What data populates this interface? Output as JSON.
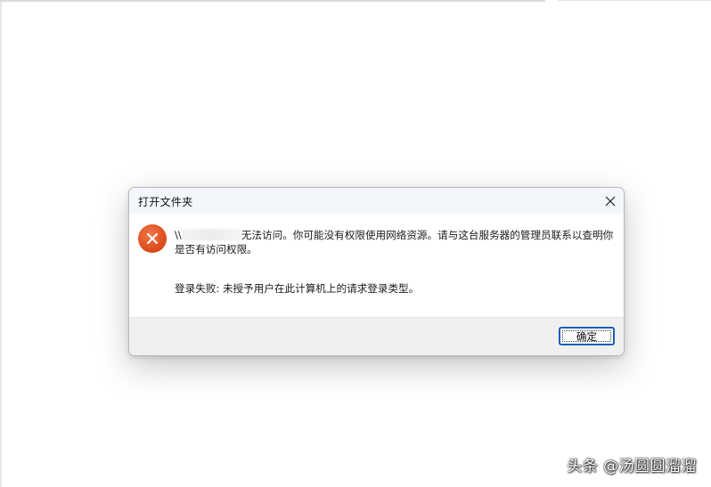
{
  "dialog": {
    "title": "打开文件夹",
    "close_glyph": "✕",
    "server_prefix": "\\\\",
    "message": "无法访问。你可能没有权限使用网络资源。请与这台服务器的管理员联系以查明你是否有访问权限。",
    "detail": "登录失败: 未授予用户在此计算机上的请求登录类型。",
    "ok_label": "确定"
  },
  "watermark": {
    "text": "头条 @汤圆圆溜溜"
  },
  "icons": {
    "error": "error-icon",
    "close": "close-icon"
  },
  "colors": {
    "error_red": "#df4e1e",
    "button_focus_border": "#1c5fb8",
    "titlebar_bg": "#f3f6fb",
    "footer_bg": "#f0f0f0"
  }
}
